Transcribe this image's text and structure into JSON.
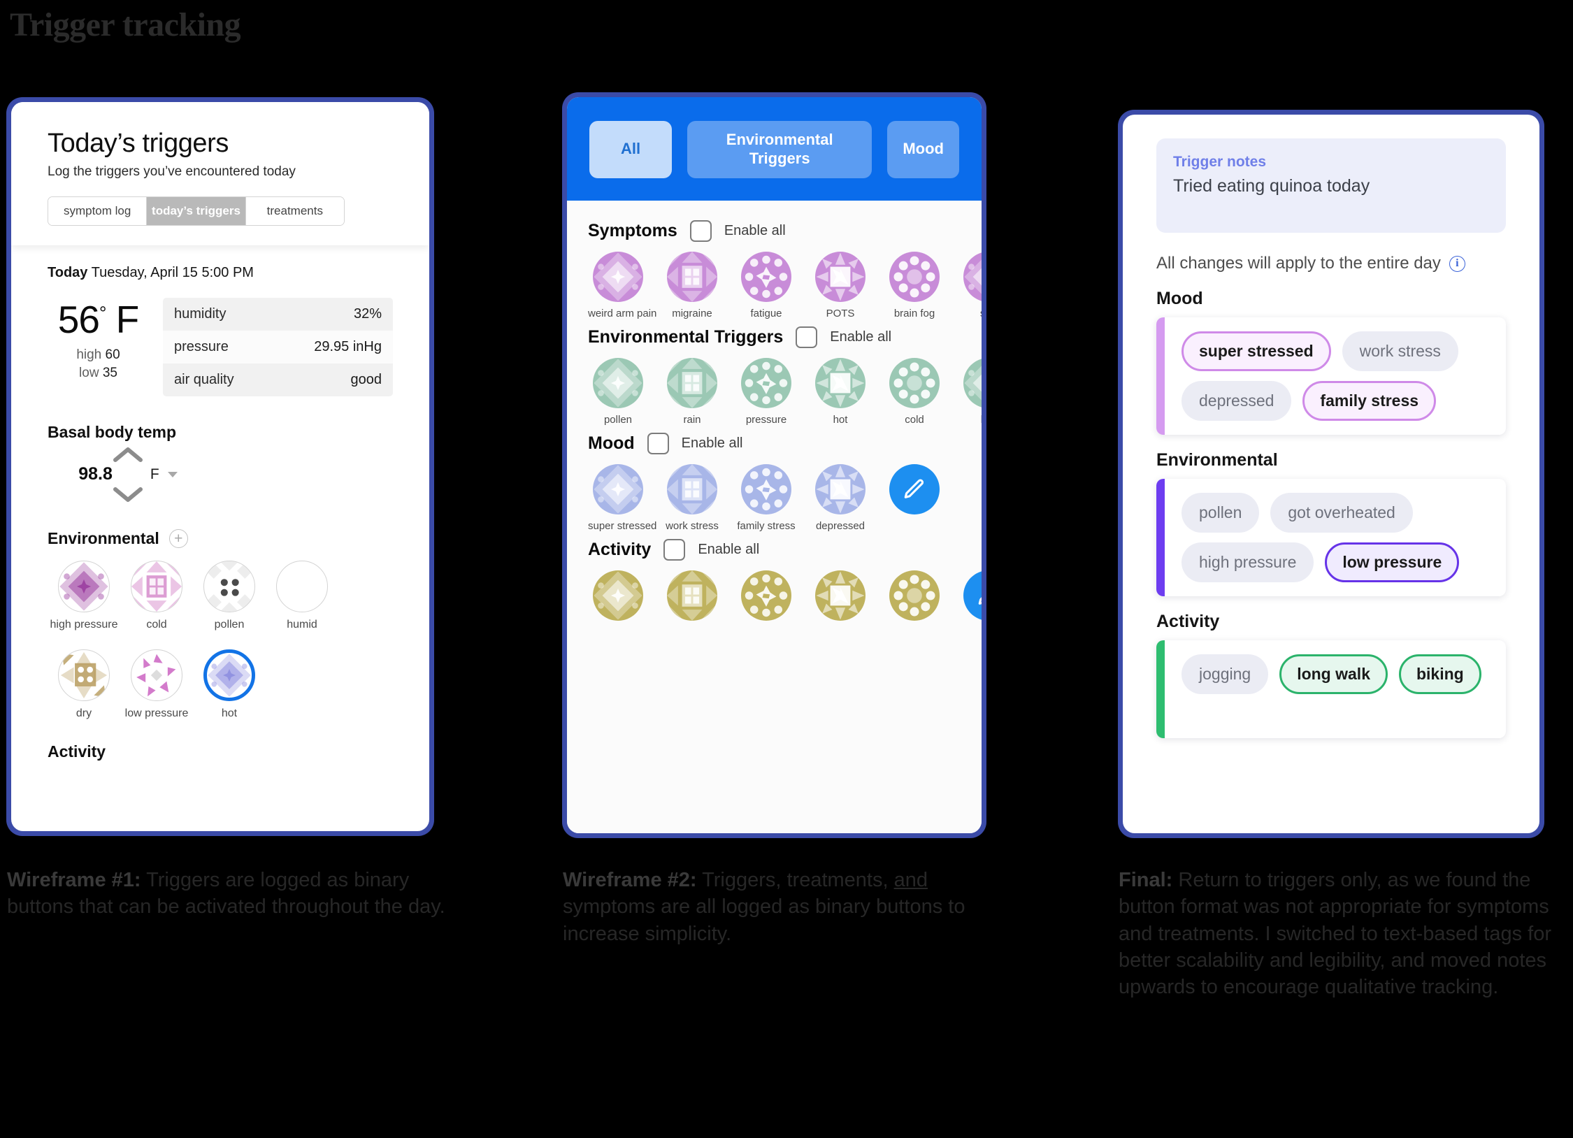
{
  "page_title": "Trigger tracking",
  "panel1": {
    "title": "Today’s triggers",
    "subtitle": "Log the triggers you’ve encountered today",
    "tabs": [
      {
        "label": "symptom log",
        "active": false
      },
      {
        "label": "today’s triggers",
        "active": true
      },
      {
        "label": "treatments",
        "active": false
      }
    ],
    "today_label": "Today",
    "today_date": "Tuesday, April 15 5:00 PM",
    "temperature": "56",
    "temperature_unit": "F",
    "degree_symbol": "°",
    "high_label": "high",
    "high_value": "60",
    "low_label": "low",
    "low_value": "35",
    "weather_rows": [
      {
        "label": "humidity",
        "value": "32%"
      },
      {
        "label": "pressure",
        "value": "29.95 inHg"
      },
      {
        "label": "air quality",
        "value": "good"
      }
    ],
    "basal_title": "Basal body temp",
    "basal_value": "98.8",
    "basal_unit": "F",
    "environmental_title": "Environmental",
    "add_icon": "+",
    "environmental_triggers": [
      {
        "label": "high pressure",
        "pattern": "diamond-burst",
        "color": "#9c3fa0",
        "selected": false
      },
      {
        "label": "cold",
        "pattern": "window",
        "color": "#c55bb6",
        "selected": false
      },
      {
        "label": "pollen",
        "pattern": "dots-four",
        "color": "#d8d8d8",
        "selected": false
      },
      {
        "label": "humid",
        "pattern": "empty",
        "color": "#ffffff",
        "selected": false
      },
      {
        "label": "dry",
        "pattern": "star-window",
        "color": "#b79b5d",
        "selected": false
      },
      {
        "label": "low pressure",
        "pattern": "pinwheel",
        "color": "#cf6dc6",
        "selected": false
      },
      {
        "label": "hot",
        "pattern": "diamond-burst",
        "color": "#8e8fe0",
        "selected": true
      }
    ],
    "activity_title": "Activity"
  },
  "panel2": {
    "tabs": [
      {
        "label": "All",
        "active": true
      },
      {
        "label": "Environmental Triggers",
        "active": false
      },
      {
        "label": "Mood",
        "active": false
      }
    ],
    "enable_all_label": "Enable all",
    "sections": [
      {
        "title": "Symptoms",
        "color": "#c88cd8",
        "items": [
          {
            "label": "weird arm pain",
            "pattern": "diamond-burst"
          },
          {
            "label": "migraine",
            "pattern": "window"
          },
          {
            "label": "fatigue",
            "pattern": "pinwheel-dots"
          },
          {
            "label": "POTS",
            "pattern": "star-square"
          },
          {
            "label": "brain fog",
            "pattern": "ring-dots"
          },
          {
            "label": "sha",
            "pattern": "diamond-burst"
          }
        ],
        "has_edit_button": false
      },
      {
        "title": "Environmental Triggers",
        "color": "#9bc8b4",
        "items": [
          {
            "label": "pollen",
            "pattern": "diamond-burst"
          },
          {
            "label": "rain",
            "pattern": "window"
          },
          {
            "label": "pressure",
            "pattern": "pinwheel-dots"
          },
          {
            "label": "hot",
            "pattern": "star-square"
          },
          {
            "label": "cold",
            "pattern": "ring-dots"
          },
          {
            "label": "low",
            "pattern": "diamond-burst"
          }
        ],
        "has_edit_button": false
      },
      {
        "title": "Mood",
        "color": "#a8b6e8",
        "items": [
          {
            "label": "super stressed",
            "pattern": "diamond-burst"
          },
          {
            "label": "work stress",
            "pattern": "window"
          },
          {
            "label": "family stress",
            "pattern": "pinwheel-dots"
          },
          {
            "label": "depressed",
            "pattern": "star-square"
          }
        ],
        "has_edit_button": true,
        "edit_icon": "pencil-icon"
      },
      {
        "title": "Activity",
        "color": "#bfb25e",
        "items": [
          {
            "label": "",
            "pattern": "diamond-burst"
          },
          {
            "label": "",
            "pattern": "window"
          },
          {
            "label": "",
            "pattern": "pinwheel-dots"
          },
          {
            "label": "",
            "pattern": "star-square"
          },
          {
            "label": "",
            "pattern": "ring-dots"
          }
        ],
        "has_edit_button": true,
        "edit_icon": "pencil-icon"
      }
    ]
  },
  "panel3": {
    "notes_label": "Trigger notes",
    "notes_text": "Tried eating quinoa today",
    "apply_text": "All changes will apply to the entire day",
    "info_icon": "info-icon",
    "groups": [
      {
        "title": "Mood",
        "bar_color": "#d59bf0",
        "accent": "#cf8ae8",
        "selected_bg": "#faf0fe",
        "tags": [
          {
            "label": "super stressed",
            "selected": true
          },
          {
            "label": "work stress",
            "selected": false
          },
          {
            "label": "depressed",
            "selected": false
          },
          {
            "label": "family stress",
            "selected": true
          }
        ]
      },
      {
        "title": "Environmental",
        "bar_color": "#6d3df0",
        "accent": "#6633e8",
        "selected_bg": "#f0ebfe",
        "tags": [
          {
            "label": "pollen",
            "selected": false
          },
          {
            "label": "got overheated",
            "selected": false
          },
          {
            "label": "high pressure",
            "selected": false
          },
          {
            "label": "low pressure",
            "selected": true
          }
        ]
      },
      {
        "title": "Activity",
        "bar_color": "#2ebd70",
        "accent": "#2bb36b",
        "selected_bg": "#e6f7ee",
        "tags": [
          {
            "label": "jogging",
            "selected": false
          },
          {
            "label": "long walk",
            "selected": true
          },
          {
            "label": "biking",
            "selected": true
          }
        ]
      }
    ]
  },
  "captions": {
    "c1_bold": "Wireframe #1:",
    "c1_text": " Triggers are logged as binary buttons that can be activated throughout the day.",
    "c2_bold": "Wireframe #2:",
    "c2_a": " Triggers, treatments, ",
    "c2_u": "and",
    "c2_b": " symptoms are all logged as binary buttons to increase simplicity.",
    "c3_bold": "Final:",
    "c3_text": " Return to triggers only, as we found the button format was not appropriate for symptoms and treatments. I switched to text-based tags for better scalability and legibility, and moved notes upwards to encourage qualitative tracking."
  }
}
